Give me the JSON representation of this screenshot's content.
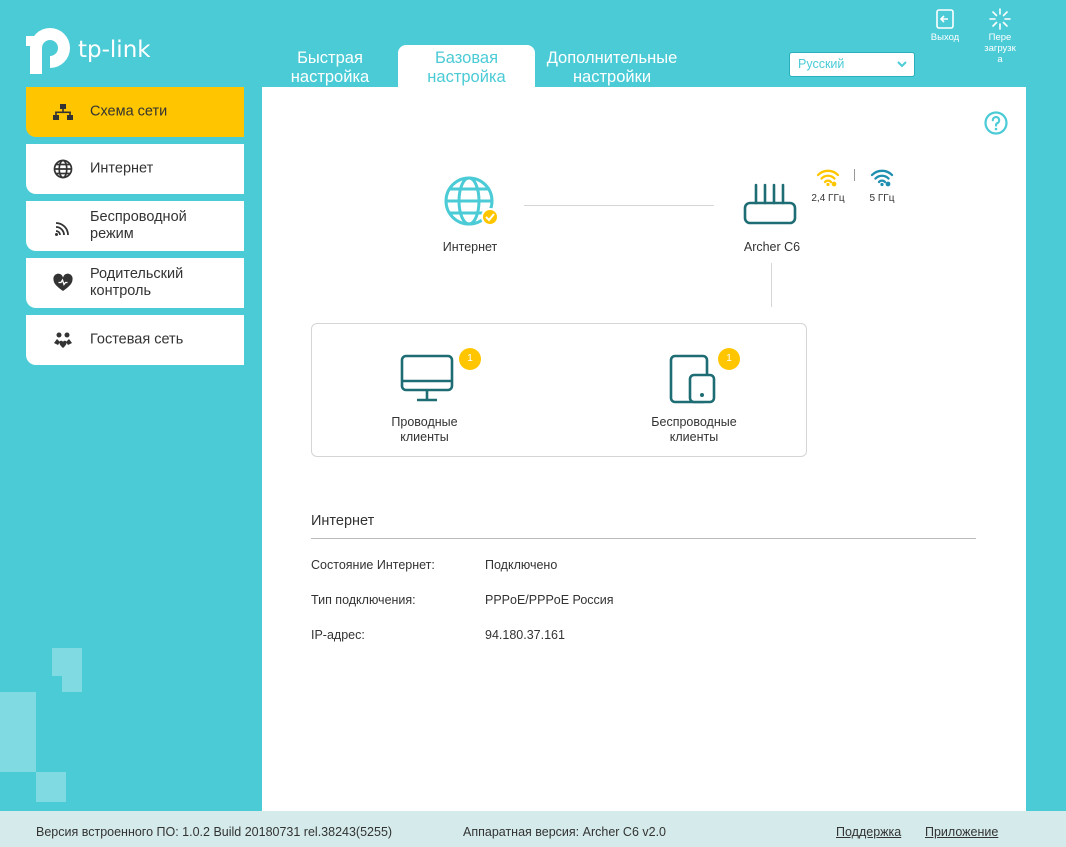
{
  "brand": {
    "logo_text": "tp-link"
  },
  "tabs": [
    {
      "label_line1": "Быстрая",
      "label_line2": "настройка",
      "active": false
    },
    {
      "label_line1": "Базовая",
      "label_line2": "настройка",
      "active": true
    },
    {
      "label_line1": "Дополнительные",
      "label_line2": "настройки",
      "active": false
    }
  ],
  "language": {
    "selected": "Русский"
  },
  "top_actions": {
    "exit_label": "Выход",
    "reboot_label_line1": "Пере",
    "reboot_label_line2": "загрузк",
    "reboot_label_line3": "а"
  },
  "sidebar": {
    "items": [
      {
        "label_line1": "Схема сети",
        "label_line2": "",
        "icon": "network-map-icon",
        "active": true
      },
      {
        "label_line1": "Интернет",
        "label_line2": "",
        "icon": "globe-icon",
        "active": false
      },
      {
        "label_line1": "Беспроводной",
        "label_line2": "режим",
        "icon": "wireless-icon",
        "active": false
      },
      {
        "label_line1": "Родительский",
        "label_line2": "контроль",
        "icon": "heart-icon",
        "active": false
      },
      {
        "label_line1": "Гостевая сеть",
        "label_line2": "",
        "icon": "guest-network-icon",
        "active": false
      }
    ]
  },
  "map": {
    "internet_label": "Интернет",
    "router_label": "Archer C6",
    "band_24_label": "2,4 ГГц",
    "band_5_label": "5 ГГц",
    "wired_clients": {
      "label_line1": "Проводные",
      "label_line2": "клиенты",
      "count": "1"
    },
    "wireless_clients": {
      "label_line1": "Беспроводные",
      "label_line2": "клиенты",
      "count": "1"
    }
  },
  "internet_section": {
    "title": "Интернет",
    "rows": [
      {
        "label": "Состояние Интернет:",
        "value": "Подключено"
      },
      {
        "label": "Тип подключения:",
        "value": "PPPoE/PPPoE Россия"
      },
      {
        "label": "IP-адрес:",
        "value": "94.180.37.161"
      }
    ]
  },
  "footer": {
    "firmware": "Версия встроенного ПО: 1.0.2 Build 20180731 rel.38243(5255)",
    "hardware": "Аппаратная версия: Archer C6 v2.0",
    "support_link": "Поддержка",
    "app_link": "Приложение"
  },
  "colors": {
    "background": "#4acbd6",
    "accent_yellow": "#ffc600",
    "icon_teal": "#1f6d74"
  }
}
